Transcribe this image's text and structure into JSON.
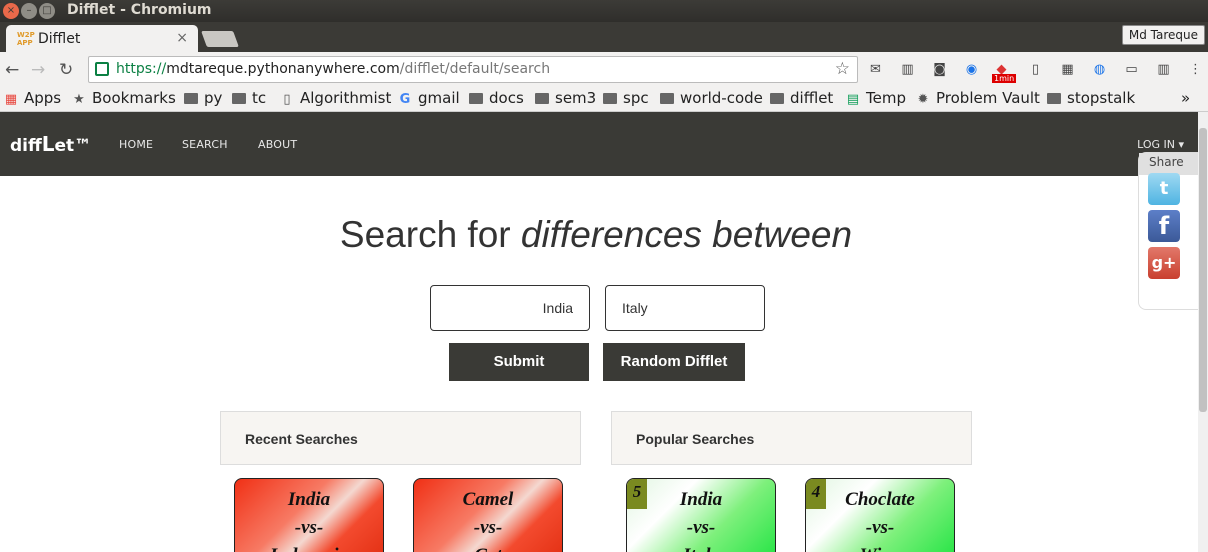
{
  "window": {
    "title": "Difflet - Chromium"
  },
  "tab": {
    "title": "Difflet",
    "close": "×"
  },
  "profile": {
    "name": "Md Tareque"
  },
  "omnibox": {
    "scheme": "https://",
    "host": "mdtareque.pythonanywhere.com",
    "path": "/difflet/default/search"
  },
  "bookmarks": {
    "items": [
      "Apps",
      "Bookmarks",
      "py",
      "tc",
      "Algorithmist",
      "gmail",
      "docs",
      "sem3",
      "spc",
      "world-code",
      "difflet",
      "Temp",
      "Problem Vault",
      "stopstalk"
    ],
    "more": "»"
  },
  "extensions": {
    "timer_badge": "1min"
  },
  "site": {
    "brand": {
      "part1": "diff",
      "part2": "L",
      "part3": "et™"
    },
    "nav": [
      "HOME",
      "SEARCH",
      "ABOUT"
    ],
    "login": "LOG IN ▾",
    "share_label": "Share"
  },
  "main": {
    "headline_plain": "Search for ",
    "headline_em": "differences between",
    "input1_value": "India",
    "input2_value": "Italy",
    "submit_label": "Submit",
    "random_label": "Random Difflet",
    "recent_title": "Recent Searches",
    "popular_title": "Popular Searches",
    "recent_cards": [
      {
        "a": "India",
        "vs": "-vs-",
        "b": "Indonesia"
      },
      {
        "a": "Camel",
        "vs": "-vs-",
        "b": "Cat"
      }
    ],
    "popular_cards": [
      {
        "count": "5",
        "a": "India",
        "vs": "-vs-",
        "b": "Italy"
      },
      {
        "count": "4",
        "a": "Choclate",
        "vs": "-vs-",
        "b": "Wine"
      }
    ]
  },
  "colors": {
    "navbar": "#3a3a36",
    "recent_card": "#f03015",
    "popular_card": "#1de340",
    "url_green": "#0b8043"
  }
}
